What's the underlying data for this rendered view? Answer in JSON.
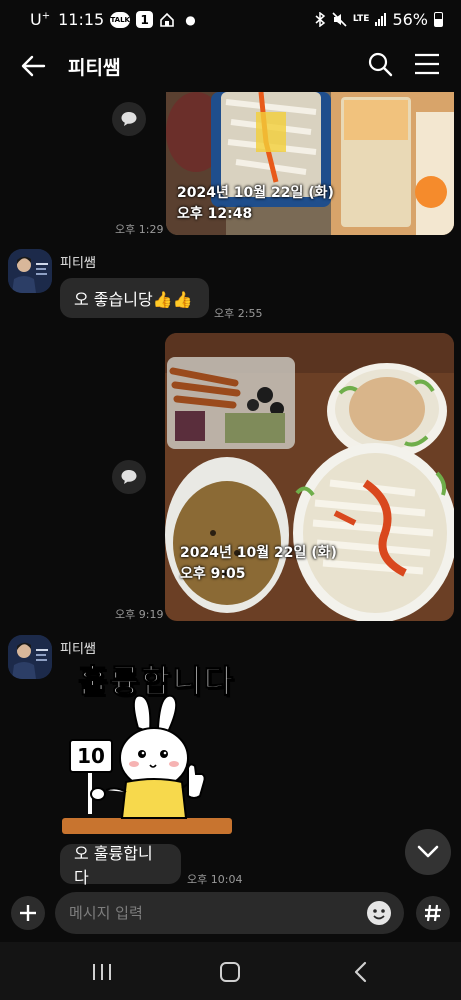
{
  "status_bar": {
    "carrier": "U",
    "carrier_sup": "+",
    "time": "11:15",
    "talk_badge": "TALK",
    "notification_count": "1",
    "network": "LTE",
    "battery": "56%"
  },
  "header": {
    "title": "피티쌤"
  },
  "messages": {
    "photo1": {
      "stamp_date": "2024년 10월 22일 (화)",
      "stamp_time": "오후 12:48",
      "time": "오후 1:29"
    },
    "reply1": {
      "sender": "피티쌤",
      "text": "오 좋습니당👍👍",
      "time": "오후 2:55"
    },
    "photo2": {
      "stamp_date": "2024년 10월 22일 (화)",
      "stamp_time": "오후 9:05",
      "time": "오후 9:19"
    },
    "reply2": {
      "sender": "피티쌤",
      "sticker_text": "훌륭합니다",
      "sticker_card": "10",
      "text": "오 훌륭합니다",
      "time": "오후 10:04"
    }
  },
  "input": {
    "placeholder": "메시지 입력"
  },
  "colors": {
    "background": "#0b0b0b",
    "bubble": "#2a2a2a",
    "sticker_collar": "#f7d94c"
  }
}
